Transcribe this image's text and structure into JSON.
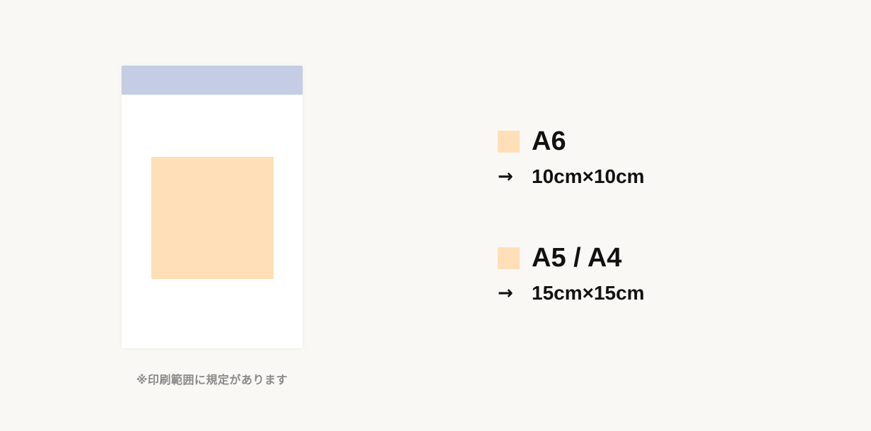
{
  "paper": {
    "note": "※印刷範囲に規定があります"
  },
  "colors": {
    "background": "#faf8f5",
    "paper": "#ffffff",
    "header_band": "#c4cde3",
    "print_area": "#ffdfb8",
    "text": "#111111",
    "note_text": "#8a8a8a"
  },
  "specs": [
    {
      "size": "A6",
      "arrow": "→",
      "dimensions": "10cm×10cm"
    },
    {
      "size": "A5 / A4",
      "arrow": "→",
      "dimensions": "15cm×15cm"
    }
  ]
}
